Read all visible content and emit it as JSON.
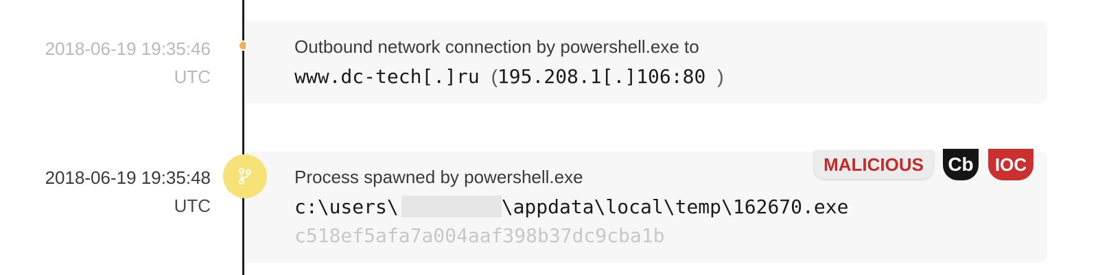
{
  "events": [
    {
      "date": "2018-06-19 19:35:46",
      "tz": "UTC",
      "marker_color": "#f2ad55",
      "description": "Outbound network connection by powershell.exe to",
      "host": "www.dc-tech[.]ru",
      "paren_open": "(",
      "address": "195.208.1[.]106:80",
      "paren_close": ")"
    },
    {
      "date": "2018-06-19 19:35:48",
      "tz": "UTC",
      "marker_color": "#f6e277",
      "marker_icon": "branch-icon",
      "description": "Process spawned by powershell.exe",
      "path_prefix": "c:\\users\\",
      "path_suffix": "\\appdata\\local\\temp\\162670.exe",
      "hash": "c518ef5afa7a004aaf398b37dc9cba1b",
      "badges": {
        "malicious": "MALICIOUS",
        "cb": "Cb",
        "ioc": "IOC"
      }
    }
  ]
}
